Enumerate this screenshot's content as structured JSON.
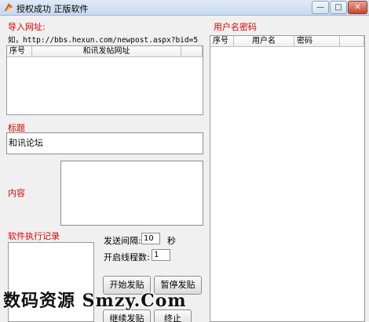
{
  "window": {
    "title": "授权成功 正版软件",
    "minimize": "—",
    "maximize": "□",
    "close": "✕"
  },
  "import": {
    "label": "导入网址:",
    "example": "如，http://bbs.hexun.com/newpost.aspx?bid=5",
    "columns": [
      "序号",
      "和讯发帖网址"
    ]
  },
  "title_section": {
    "label": "标题",
    "value": "和讯论坛"
  },
  "content_section": {
    "label": "内容",
    "value": ""
  },
  "log_section": {
    "label": "软件执行记录"
  },
  "settings": {
    "interval_label": "发送间隔:",
    "interval_value": "10",
    "interval_unit": "秒",
    "threads_label": "开启线程数:",
    "threads_value": "1"
  },
  "buttons": {
    "start": "开始发贴",
    "pause": "暂停发贴",
    "continue": "继续发贴",
    "stop": "终止"
  },
  "accounts": {
    "label": "用户名密码",
    "columns": [
      "序号",
      "用户名",
      "密码"
    ]
  },
  "watermark": "数码资源 Smzy.Com"
}
